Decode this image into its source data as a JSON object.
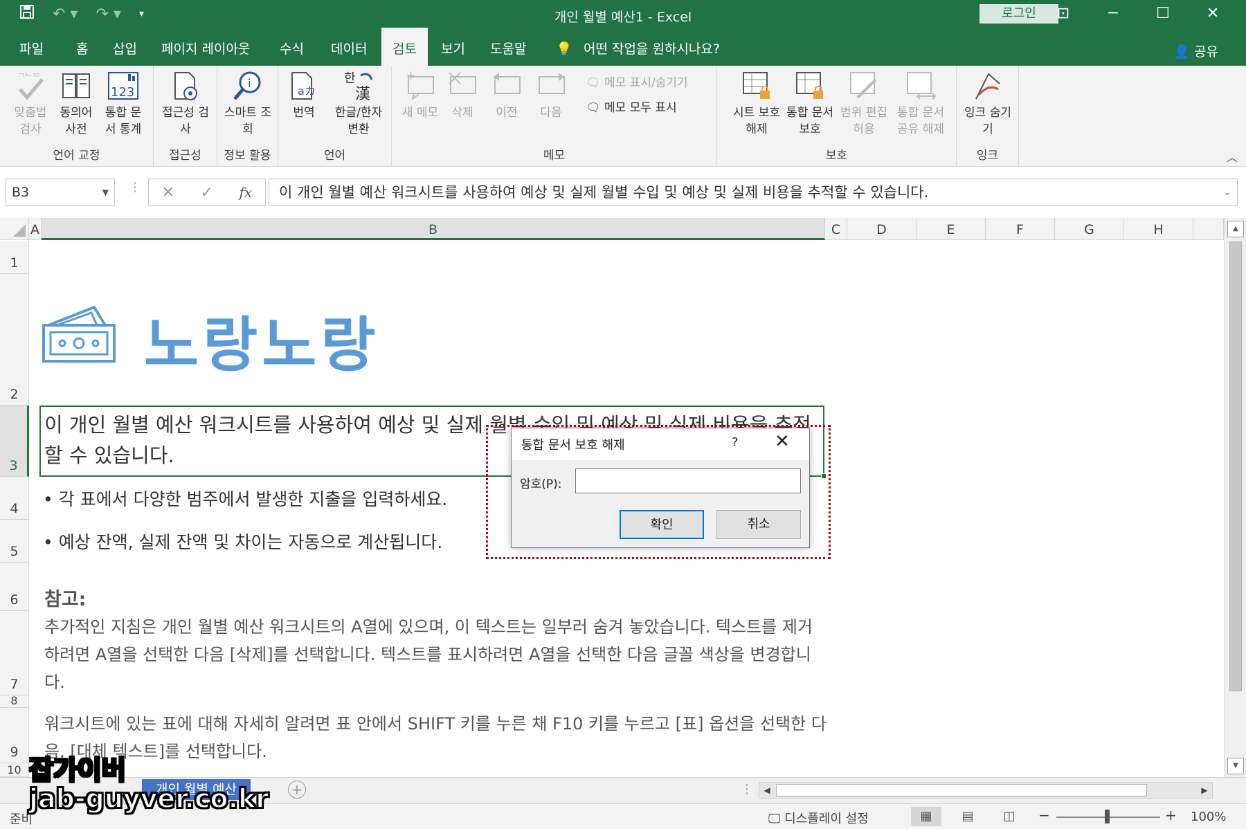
{
  "titlebar": {
    "title": "개인 월별 예산1  -  Excel",
    "login_label": "로그인",
    "qat_icons": [
      "save-icon",
      "undo-icon",
      "redo-icon",
      "customize-icon"
    ],
    "colors": {
      "excel_green": "#217346",
      "accent_blue": "#5b9bd5"
    }
  },
  "tabs": {
    "items": [
      "파일",
      "홈",
      "삽입",
      "페이지 레이아웃",
      "수식",
      "데이터",
      "검토",
      "보기",
      "도움말"
    ],
    "active": "검토",
    "tell_me": "어떤 작업을 원하시나요?",
    "share": "공유"
  },
  "ribbon": {
    "groups": {
      "proofing": {
        "label": "언어 교정",
        "buttons": [
          "맞춤법 검사",
          "동의어 사전",
          "통합 문서 통계"
        ]
      },
      "accessibility": {
        "label": "접근성",
        "buttons": [
          "접근성 검사"
        ]
      },
      "insights": {
        "label": "정보 활용",
        "buttons": [
          "스마트 조회"
        ]
      },
      "language": {
        "label": "언어",
        "buttons": [
          "번역",
          "한글/한자 변환"
        ]
      },
      "comments": {
        "label": "메모",
        "buttons": [
          "새 메모",
          "삭제",
          "이전",
          "다음"
        ],
        "show_hide": "메모 표시/숨기기",
        "show_all": "메모 모두 표시"
      },
      "protect": {
        "label": "보호",
        "buttons": [
          "시트 보호 해제",
          "통합 문서 보호",
          "범위 편집 허용",
          "통합 문서 공유 해제"
        ]
      },
      "ink": {
        "label": "잉크",
        "buttons": [
          "잉크 숨기기"
        ]
      }
    }
  },
  "formula_bar": {
    "name_box": "B3",
    "fx": "fx",
    "content": "이 개인 월별 예산 워크시트를 사용하여 예상 및 실제 월별 수입 및 예상 및 실제 비용을 추적할 수 있습니다."
  },
  "columns": [
    "A",
    "B",
    "C",
    "D",
    "E",
    "F",
    "G",
    "H"
  ],
  "rows": [
    "1",
    "2",
    "3",
    "4",
    "5",
    "6",
    "7",
    "8",
    "9",
    "10"
  ],
  "sheet": {
    "brand_title": "노랑노랑",
    "b3": "이 개인 월별 예산 워크시트를 사용하여 예상 및 실제 월별 수입 및 예상 및 실제 비용을 추적할 수 있습니다.",
    "b4": "• 각 표에서 다양한 범주에서 발생한 지출을 입력하세요.",
    "b5": "• 예상 잔액, 실제 잔액 및 차이는 자동으로 계산됩니다.",
    "b6": "참고:",
    "b7": "추가적인 지침은 개인 월별 예산 워크시트의 A열에 있으며, 이 텍스트는 일부러 숨겨 놓았습니다. 텍스트를 제거하려면 A열을 선택한 다음 [삭제]를 선택합니다. 텍스트를 표시하려면 A열을 선택한 다음 글꼴 색상을 변경합니다.",
    "b9": "워크시트에 있는 표에 대해 자세히 알려면 표 안에서 SHIFT 키를 누른 채 F10 키를 누르고 [표] 옵션을 선택한 다음, [대체 텍스트]를 선택합니다."
  },
  "sheet_tabs": {
    "active": "개인 월별 예산"
  },
  "status": {
    "ready": "준비",
    "display_settings": "디스플레이 설정",
    "zoom": "100%"
  },
  "dialog": {
    "title": "통합 문서 보호 해제",
    "help": "?",
    "close": "✕",
    "password_label": "암호(P):",
    "password_value": "",
    "ok": "확인",
    "cancel": "취소"
  },
  "watermark": {
    "line1": "잡가이버",
    "line2": "jab-guyver.co.kr"
  }
}
